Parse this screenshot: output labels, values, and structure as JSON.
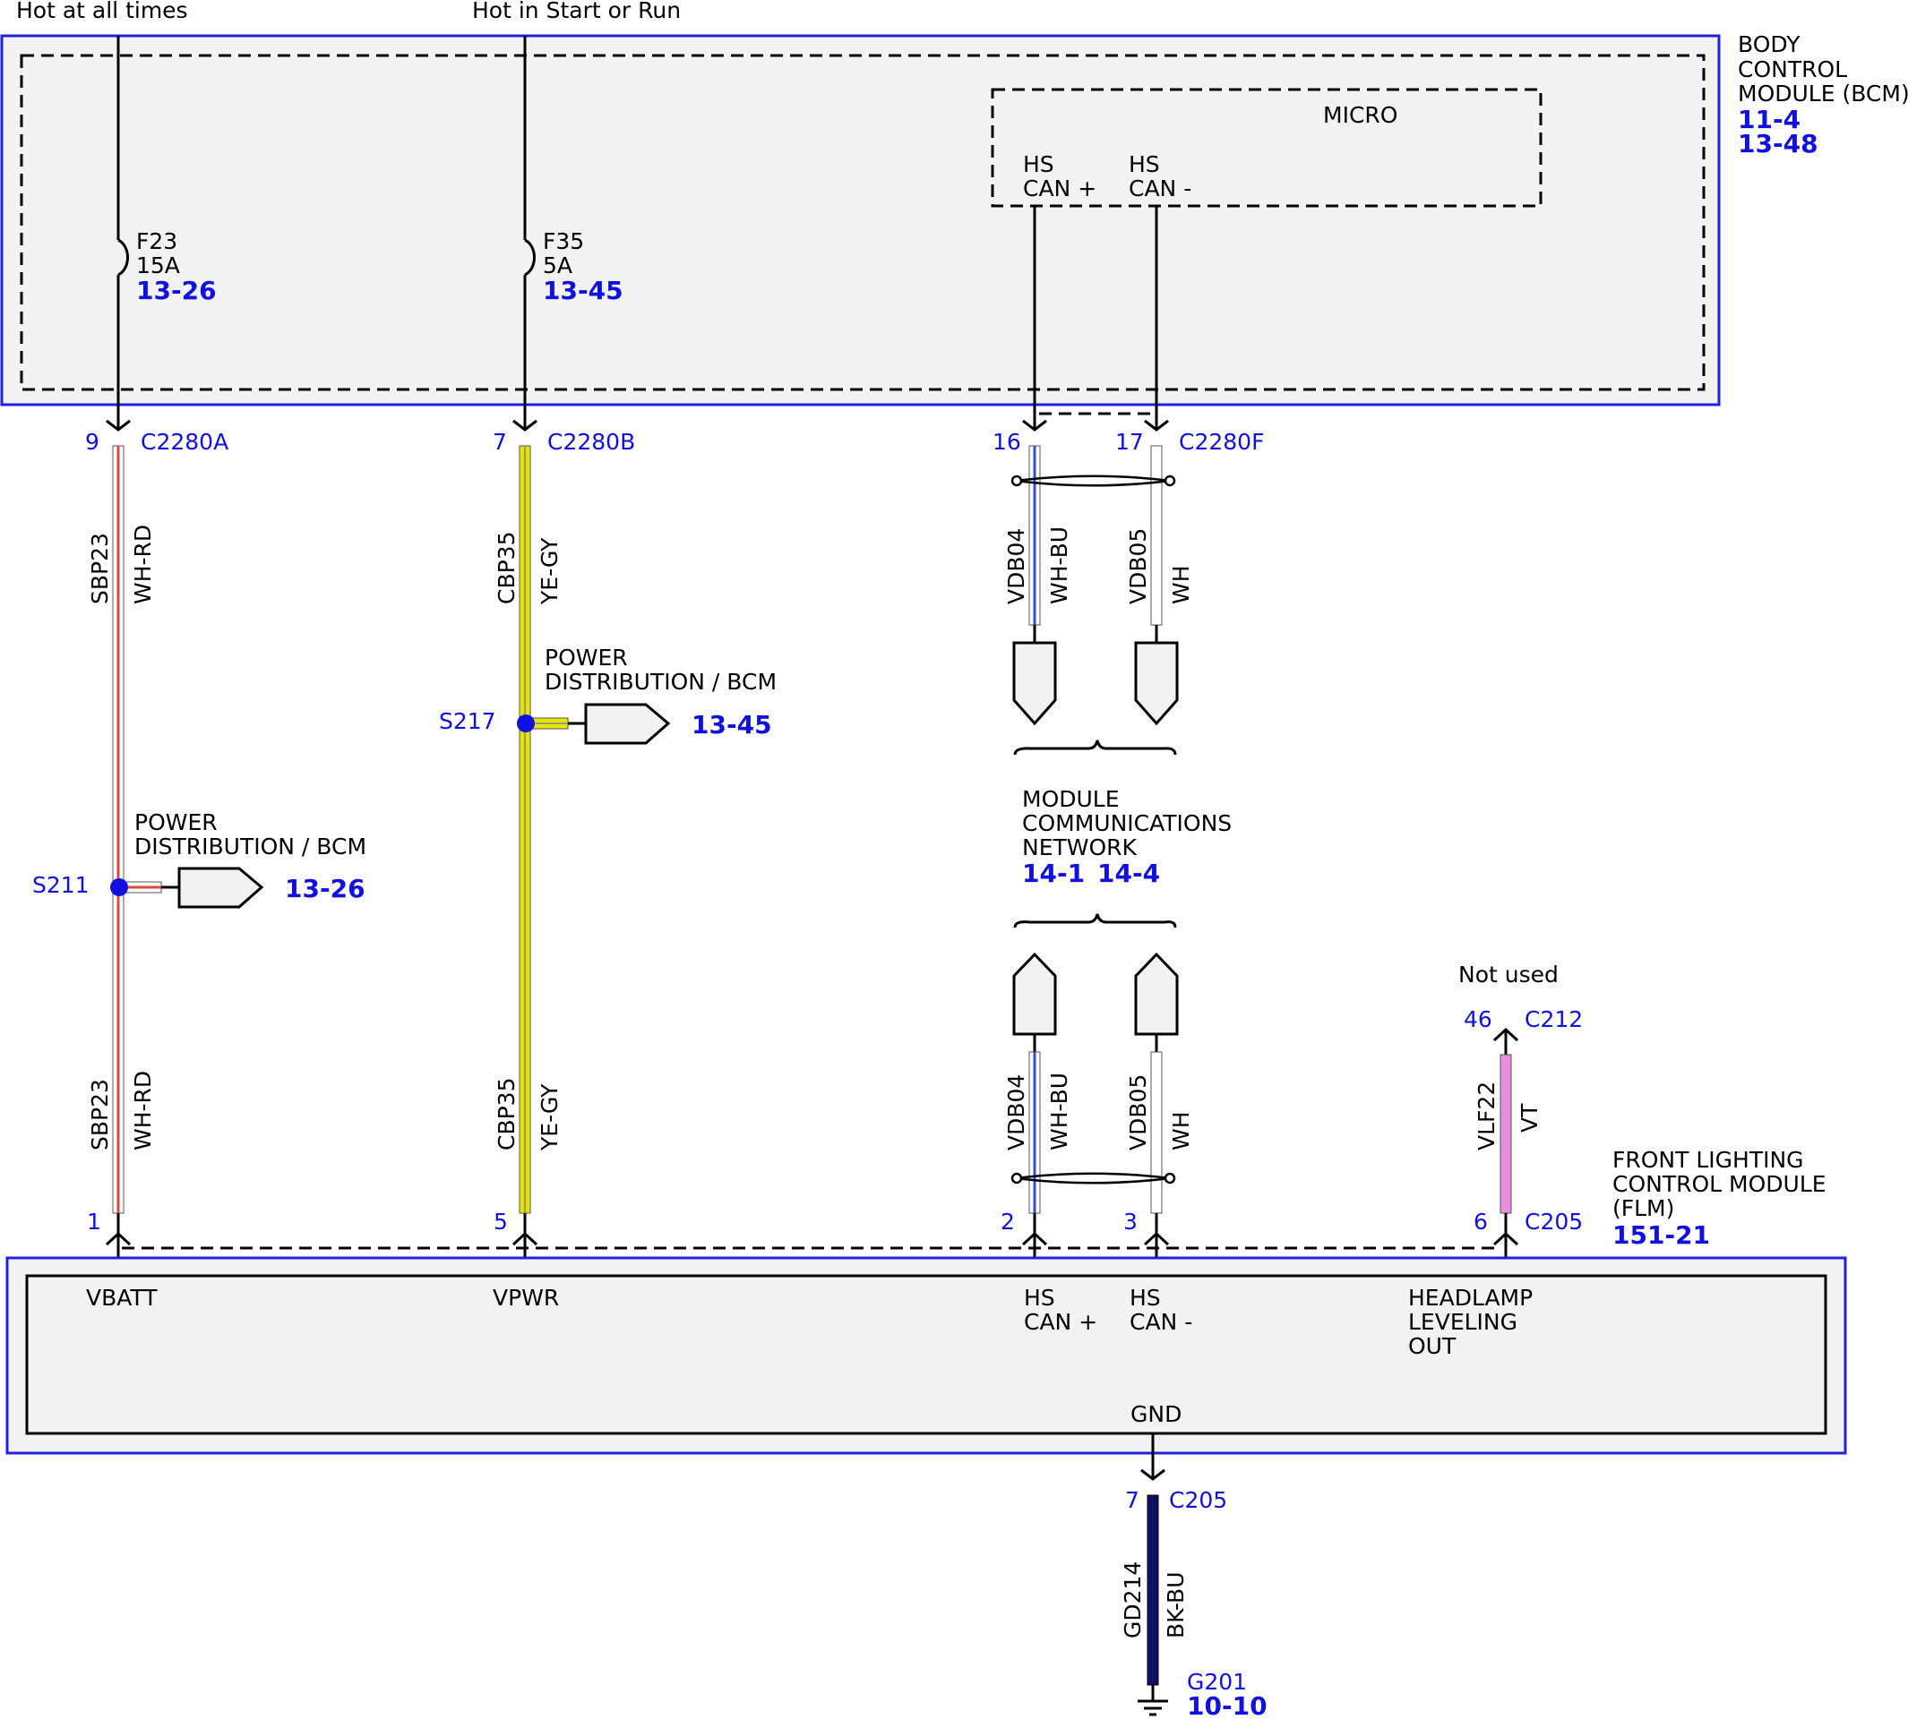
{
  "colors": {
    "pin_blue": "#1010e0",
    "module_outline": "#2020e0",
    "module_fill": "#f2f2f2",
    "wh_rd": "#d84a3c",
    "ye_gy": "#e6e600",
    "wh_bu": "#3050e0",
    "vt": "#e890e0",
    "bk_bu": "#101060"
  },
  "top_labels": {
    "hot_always": "Hot at all times",
    "hot_start_run": "Hot in Start or Run"
  },
  "bcm": {
    "name_lines": [
      "BODY",
      "CONTROL",
      "MODULE (BCM)"
    ],
    "refs": [
      "11-4",
      "13-48"
    ],
    "micro": "MICRO",
    "hs_can_plus": [
      "HS",
      "CAN +"
    ],
    "hs_can_minus": [
      "HS",
      "CAN -"
    ],
    "fuse1": {
      "id": "F23",
      "rating": "15A",
      "ref": "13-26"
    },
    "fuse2": {
      "id": "F35",
      "rating": "5A",
      "ref": "13-45"
    }
  },
  "connectors": {
    "c2280a": {
      "pin": "9",
      "name": "C2280A"
    },
    "c2280b": {
      "pin": "7",
      "name": "C2280B"
    },
    "c2280f": {
      "pin16": "16",
      "pin17": "17",
      "name": "C2280F"
    },
    "flm": {
      "pin1": "1",
      "pin5": "5",
      "pin2": "2",
      "pin3": "3",
      "pin6": "6",
      "name": "C205"
    },
    "c212": {
      "pin": "46",
      "name": "C212"
    },
    "gnd": {
      "pin": "7",
      "name": "C205"
    }
  },
  "wires": {
    "sbp23": {
      "circuit": "SBP23",
      "color": "WH-RD"
    },
    "cbp35": {
      "circuit": "CBP35",
      "color": "YE-GY"
    },
    "vdb04": {
      "circuit": "VDB04",
      "color": "WH-BU"
    },
    "vdb05": {
      "circuit": "VDB05",
      "color": "WH"
    },
    "vlf22": {
      "circuit": "VLF22",
      "color": "VT"
    },
    "gd214": {
      "circuit": "GD214",
      "color": "BK-BU"
    }
  },
  "splices": {
    "s211": {
      "id": "S211",
      "dest": [
        "POWER",
        "DISTRIBUTION / BCM"
      ],
      "ref": "13-26"
    },
    "s217": {
      "id": "S217",
      "dest": [
        "POWER",
        "DISTRIBUTION / BCM"
      ],
      "ref": "13-45"
    }
  },
  "network": {
    "name_lines": [
      "MODULE",
      "COMMUNICATIONS",
      "NETWORK"
    ],
    "refs": [
      "14-1",
      "14-4"
    ]
  },
  "not_used": "Not used",
  "flm": {
    "name_lines": [
      "FRONT LIGHTING",
      "CONTROL MODULE",
      "(FLM)"
    ],
    "ref": "151-21",
    "vbatt": "VBATT",
    "vpwr": "VPWR",
    "hs_can_plus": [
      "HS",
      "CAN +"
    ],
    "hs_can_minus": [
      "HS",
      "CAN -"
    ],
    "headlamp": [
      "HEADLAMP",
      "LEVELING",
      "OUT"
    ],
    "gnd": "GND"
  },
  "ground": {
    "id": "G201",
    "ref": "10-10"
  }
}
